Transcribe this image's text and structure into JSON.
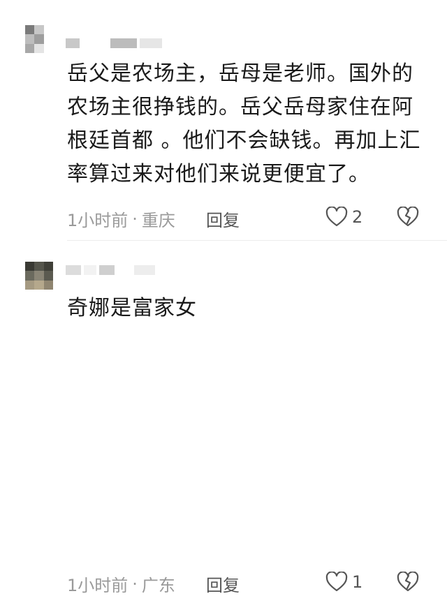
{
  "comments": [
    {
      "username": "",
      "text_lines": [
        "岳父是农场主，岳母是老师。国外的",
        "农场主很挣钱的。岳父岳母家住在阿",
        "根廷首都 。他们不会缺钱。再加上汇",
        "率算过来对他们来说更便宜了。"
      ],
      "time": "1小时前",
      "location": "重庆",
      "reply_label": "回复",
      "like_count": "2",
      "icons": [
        "heart-outline-icon",
        "broken-heart-icon"
      ]
    },
    {
      "username": "",
      "text_lines": [
        "奇娜是富家女"
      ],
      "time": "1小时前",
      "location": "广东",
      "reply_label": "回复",
      "like_count": "1",
      "icons": [
        "heart-outline-icon",
        "broken-heart-icon"
      ]
    }
  ],
  "colors": {
    "text": "#1a1a1a",
    "meta": "#9a9a9a",
    "action": "#555555",
    "background": "#ffffff"
  }
}
